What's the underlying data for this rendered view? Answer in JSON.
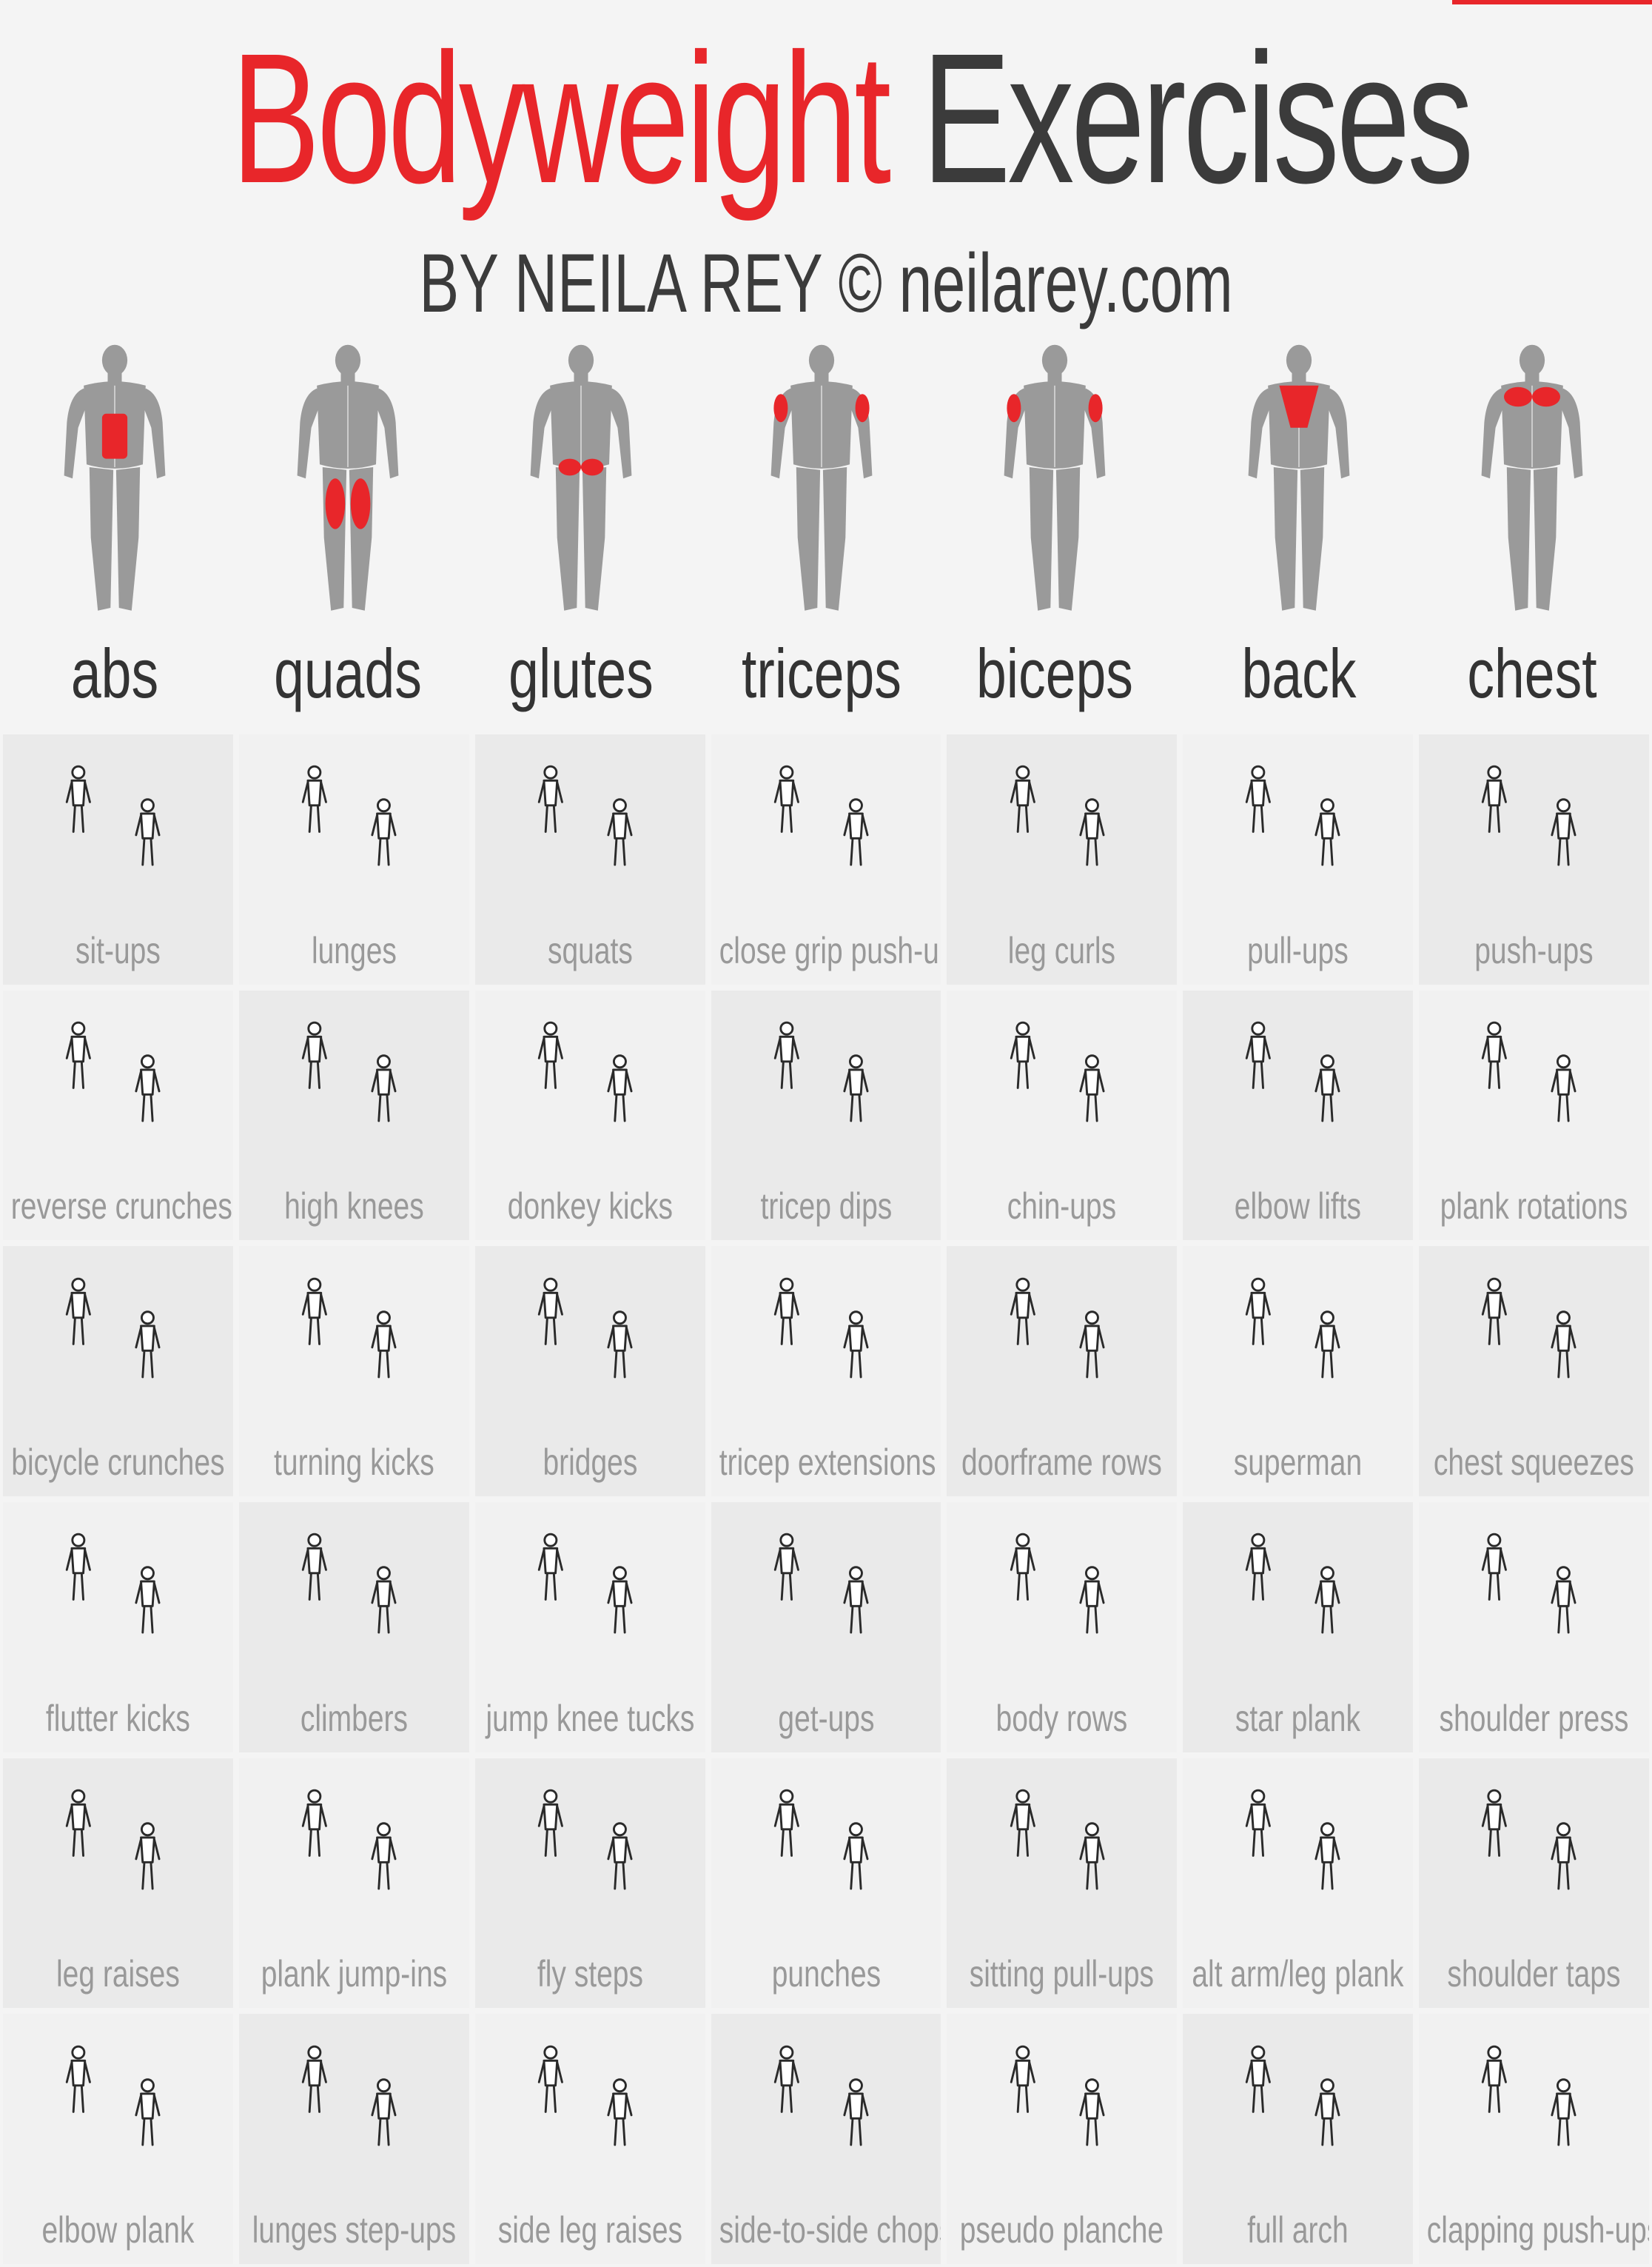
{
  "header": {
    "title_part1": "Bodyweight",
    "title_part2": "Exercises",
    "subtitle": "BY NEILA REY © neilarey.com"
  },
  "colors": {
    "accent": "#e8262a",
    "title_dark": "#3b3b3b",
    "body_gray": "#9a9a9a",
    "cell_background": "#eaeaea",
    "label_gray": "#999999"
  },
  "muscle_groups": [
    {
      "label": "abs",
      "view": "front",
      "highlight": "abs"
    },
    {
      "label": "quads",
      "view": "front",
      "highlight": "quads"
    },
    {
      "label": "glutes",
      "view": "back",
      "highlight": "glutes"
    },
    {
      "label": "triceps",
      "view": "back",
      "highlight": "triceps"
    },
    {
      "label": "biceps",
      "view": "front",
      "highlight": "biceps"
    },
    {
      "label": "back",
      "view": "back",
      "highlight": "back"
    },
    {
      "label": "chest",
      "view": "front",
      "highlight": "chest"
    }
  ],
  "exercise_rows": [
    [
      "sit-ups",
      "lunges",
      "squats",
      "close grip push-ups",
      "leg curls",
      "pull-ups",
      "push-ups"
    ],
    [
      "reverse crunches",
      "high knees",
      "donkey kicks",
      "tricep dips",
      "chin-ups",
      "elbow lifts",
      "plank rotations"
    ],
    [
      "bicycle crunches",
      "turning kicks",
      "bridges",
      "tricep extensions",
      "doorframe rows",
      "superman",
      "chest squeezes"
    ],
    [
      "flutter kicks",
      "climbers",
      "jump knee tucks",
      "get-ups",
      "body rows",
      "star plank",
      "shoulder press"
    ],
    [
      "leg raises",
      "plank jump-ins",
      "fly steps",
      "punches",
      "sitting pull-ups",
      "alt arm/leg plank",
      "shoulder taps"
    ],
    [
      "elbow plank",
      "lunges step-ups",
      "side leg raises",
      "side-to-side chops",
      "pseudo planche",
      "full arch",
      "clapping push-ups"
    ]
  ]
}
